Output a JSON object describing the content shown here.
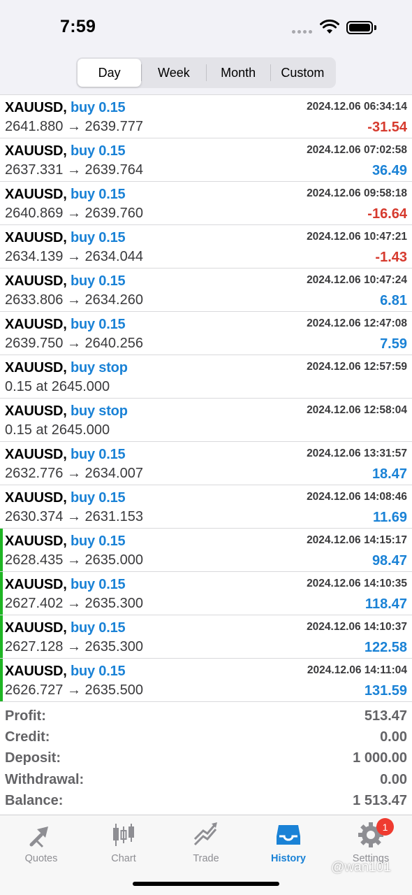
{
  "status": {
    "time": "7:59"
  },
  "periods": {
    "tabs": [
      "Day",
      "Week",
      "Month",
      "Custom"
    ],
    "selected": "Day"
  },
  "colors": {
    "accent": "#1a82d6",
    "loss": "#d63a2e",
    "highlight_bar": "#1fb524",
    "badge": "#ef3b30"
  },
  "rows": [
    {
      "symbol": "XAUUSD,",
      "side": "buy 0.15",
      "date": "2024.12.06 06:34:14",
      "prices": "2641.880 → 2639.777",
      "pl": "-31.54",
      "pl_sign": "neg",
      "highlight": false
    },
    {
      "symbol": "XAUUSD,",
      "side": "buy 0.15",
      "date": "2024.12.06 07:02:58",
      "prices": "2637.331 → 2639.764",
      "pl": "36.49",
      "pl_sign": "pos",
      "highlight": false
    },
    {
      "symbol": "XAUUSD,",
      "side": "buy 0.15",
      "date": "2024.12.06 09:58:18",
      "prices": "2640.869 → 2639.760",
      "pl": "-16.64",
      "pl_sign": "neg",
      "highlight": false
    },
    {
      "symbol": "XAUUSD,",
      "side": "buy 0.15",
      "date": "2024.12.06 10:47:21",
      "prices": "2634.139 → 2634.044",
      "pl": "-1.43",
      "pl_sign": "neg",
      "highlight": false
    },
    {
      "symbol": "XAUUSD,",
      "side": "buy 0.15",
      "date": "2024.12.06 10:47:24",
      "prices": "2633.806 → 2634.260",
      "pl": "6.81",
      "pl_sign": "pos",
      "highlight": false
    },
    {
      "symbol": "XAUUSD,",
      "side": "buy 0.15",
      "date": "2024.12.06 12:47:08",
      "prices": "2639.750 → 2640.256",
      "pl": "7.59",
      "pl_sign": "pos",
      "highlight": false
    },
    {
      "symbol": "XAUUSD,",
      "side": "buy stop",
      "date": "2024.12.06 12:57:59",
      "prices": "0.15 at 2645.000",
      "pl": "",
      "pl_sign": "pos",
      "highlight": false
    },
    {
      "symbol": "XAUUSD,",
      "side": "buy stop",
      "date": "2024.12.06 12:58:04",
      "prices": "0.15 at 2645.000",
      "pl": "",
      "pl_sign": "pos",
      "highlight": false
    },
    {
      "symbol": "XAUUSD,",
      "side": "buy 0.15",
      "date": "2024.12.06 13:31:57",
      "prices": "2632.776 → 2634.007",
      "pl": "18.47",
      "pl_sign": "pos",
      "highlight": false
    },
    {
      "symbol": "XAUUSD,",
      "side": "buy 0.15",
      "date": "2024.12.06 14:08:46",
      "prices": "2630.374 → 2631.153",
      "pl": "11.69",
      "pl_sign": "pos",
      "highlight": false
    },
    {
      "symbol": "XAUUSD,",
      "side": "buy 0.15",
      "date": "2024.12.06 14:15:17",
      "prices": "2628.435 → 2635.000",
      "pl": "98.47",
      "pl_sign": "pos",
      "highlight": true
    },
    {
      "symbol": "XAUUSD,",
      "side": "buy 0.15",
      "date": "2024.12.06 14:10:35",
      "prices": "2627.402 → 2635.300",
      "pl": "118.47",
      "pl_sign": "pos",
      "highlight": true
    },
    {
      "symbol": "XAUUSD,",
      "side": "buy 0.15",
      "date": "2024.12.06 14:10:37",
      "prices": "2627.128 → 2635.300",
      "pl": "122.58",
      "pl_sign": "pos",
      "highlight": true
    },
    {
      "symbol": "XAUUSD,",
      "side": "buy 0.15",
      "date": "2024.12.06 14:11:04",
      "prices": "2626.727 → 2635.500",
      "pl": "131.59",
      "pl_sign": "pos",
      "highlight": true
    }
  ],
  "summary": [
    {
      "label": "Profit:",
      "value": "513.47"
    },
    {
      "label": "Credit:",
      "value": "0.00"
    },
    {
      "label": "Deposit:",
      "value": "1 000.00"
    },
    {
      "label": "Withdrawal:",
      "value": "0.00"
    },
    {
      "label": "Balance:",
      "value": "1 513.47"
    }
  ],
  "tabbar": {
    "items": [
      {
        "label": "Quotes",
        "icon": "quotes-icon"
      },
      {
        "label": "Chart",
        "icon": "chart-icon"
      },
      {
        "label": "Trade",
        "icon": "trade-icon"
      },
      {
        "label": "History",
        "icon": "history-icon"
      },
      {
        "label": "Settings",
        "icon": "settings-icon"
      }
    ],
    "active": "History",
    "settings_badge": "1"
  },
  "watermark": "@wan101"
}
